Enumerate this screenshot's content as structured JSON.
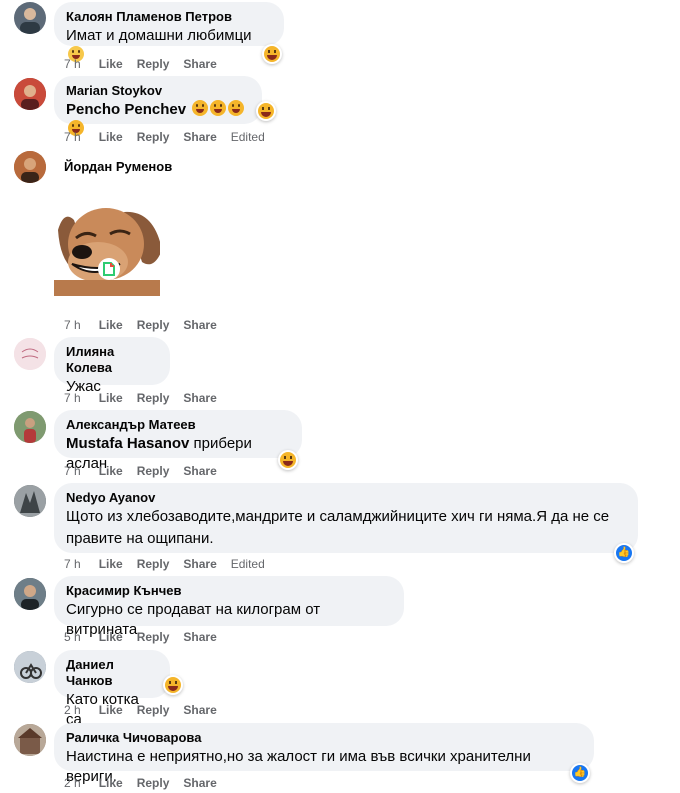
{
  "comments": [
    {
      "author": "Калоян Пламенов Петров",
      "text": "Имат и домашни любимци",
      "time": "7 h",
      "like": "Like",
      "reply": "Reply",
      "share": "Share",
      "avatar_color": "#5d6a78"
    },
    {
      "author": "Marian Stoykov",
      "mention": "Pencho Penchev",
      "time": "7 h",
      "like": "Like",
      "reply": "Reply",
      "share": "Share",
      "edited": "Edited",
      "avatar_color": "#8c2f2f"
    },
    {
      "author": "Йордан Руменов",
      "time": "7 h",
      "like": "Like",
      "reply": "Reply",
      "share": "Share",
      "avatar_color": "#a55f3c"
    },
    {
      "author": "Илияна Колева",
      "text": "Ужас",
      "time": "7 h",
      "like": "Like",
      "reply": "Reply",
      "share": "Share",
      "avatar_color": "#e7c7cf"
    },
    {
      "author": "Александър Матеев",
      "mention": "Mustafa Hasanov",
      "text": "прибери аслан",
      "time": "7 h",
      "like": "Like",
      "reply": "Reply",
      "share": "Share",
      "avatar_color": "#6f8a5e"
    },
    {
      "author": "Nedyo Ayanov",
      "text_line1": "Щото из хлебозаводите,мандрите и саламджийниците хич ги няма.Я да не се",
      "text_line2": "правите на ощипани.",
      "time": "7 h",
      "like": "Like",
      "reply": "Reply",
      "share": "Share",
      "edited": "Edited",
      "avatar_color": "#5a5f62"
    },
    {
      "author": "Красимир Кънчев",
      "text": "Сигурно се продават на килограм от витрината",
      "time": "5 h",
      "like": "Like",
      "reply": "Reply",
      "share": "Share",
      "avatar_color": "#3e4a52"
    },
    {
      "author": "Даниел Чанков",
      "text": "Като котка са",
      "time": "2 h",
      "like": "Like",
      "reply": "Reply",
      "share": "Share",
      "avatar_color": "#7a8694"
    },
    {
      "author": "Раличка Чичоварова",
      "text": "Наистина е неприятно,но за жалост ги има във всички хранителни вериги.",
      "time": "2 h",
      "like": "Like",
      "reply": "Reply",
      "share": "Share",
      "avatar_color": "#8a6b5a"
    }
  ],
  "icons": {
    "emoji": "grinning-face-icon",
    "laugh": "tears-of-joy-icon",
    "haha_reaction": "haha-reaction-icon",
    "like_reaction": "like-reaction-icon",
    "giphy": "giphy-logo-icon"
  },
  "colors": {
    "bubble": "#f0f2f5",
    "meta": "#65676b",
    "like_blue": "#1877f2",
    "haha": "#f5b52a"
  }
}
